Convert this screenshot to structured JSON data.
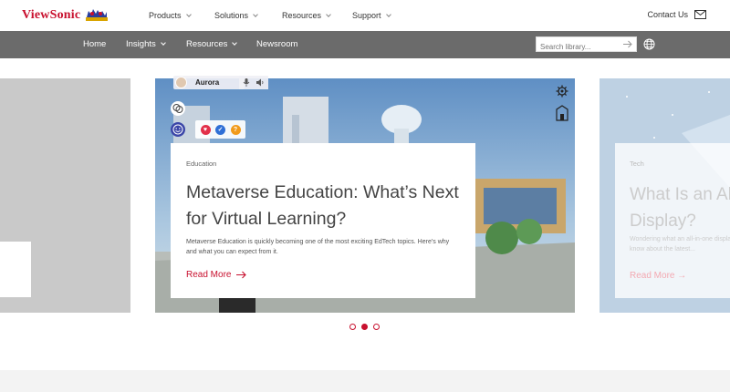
{
  "brand": {
    "name": "ViewSonic",
    "color": "#c8102e"
  },
  "topnav": {
    "items": [
      {
        "label": "Products"
      },
      {
        "label": "Solutions"
      },
      {
        "label": "Resources"
      },
      {
        "label": "Support"
      }
    ],
    "contact_label": "Contact Us",
    "contact_icon": "mail-icon"
  },
  "subnav": {
    "items": [
      {
        "label": "Home"
      },
      {
        "label": "Insights"
      },
      {
        "label": "Resources"
      },
      {
        "label": "Newsroom"
      }
    ],
    "search_placeholder": "Search library...",
    "globe_icon": "globe-icon"
  },
  "carousel": {
    "main": {
      "overlay_user": "Aurora",
      "tag": "Education",
      "title": "Metaverse Education: What’s Next for Virtual Learning?",
      "description": "Metaverse Education is quickly becoming one of the most exciting EdTech topics. Here’s why and what you can expect from it.",
      "read_more": "Read More"
    },
    "next": {
      "tag": "Tech",
      "title": "What Is an All-in-One Display?",
      "description": "Wondering what an all-in-one display is? Here’s all there’s to know about the latest...",
      "read_more": "Read More"
    },
    "dot_count": 3,
    "active_index": 1
  },
  "colors": {
    "subbar": "#6b6b6b",
    "accent": "#c8102e"
  }
}
